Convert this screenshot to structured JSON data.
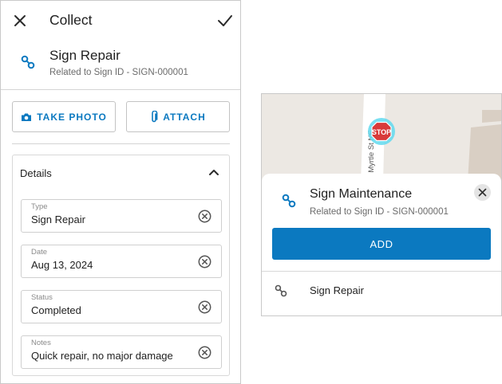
{
  "collect_form": {
    "header": {
      "close_icon": "close-icon",
      "title": "Collect",
      "confirm_icon": "check-icon"
    },
    "feature": {
      "icon": "link-icon",
      "title": "Sign Repair",
      "subtitle": "Related to Sign ID - SIGN-000001"
    },
    "actions": {
      "take_photo": {
        "icon": "camera-icon",
        "label": "TAKE PHOTO"
      },
      "attach": {
        "icon": "paperclip-icon",
        "label": "ATTACH"
      }
    },
    "details": {
      "title": "Details",
      "expanded": true,
      "fields": [
        {
          "label": "Type",
          "value": "Sign Repair"
        },
        {
          "label": "Date",
          "value": "Aug 13, 2024"
        },
        {
          "label": "Status",
          "value": "Completed"
        },
        {
          "label": "Notes",
          "value": "Quick repair, no major damage"
        }
      ]
    }
  },
  "map_popup": {
    "map": {
      "street_label": "Myrtle St NE",
      "marker_label": "STOP"
    },
    "sheet": {
      "icon": "link-icon",
      "title": "Sign Maintenance",
      "subtitle": "Related to Sign ID - SIGN-000001",
      "close_icon": "close-icon",
      "add_label": "ADD",
      "related_items": [
        {
          "icon": "link-icon",
          "label": "Sign Repair"
        }
      ]
    }
  },
  "colors": {
    "accent": "#0b79c0",
    "stop_sign": "#d83a3a",
    "map_background": "#ece8e3",
    "building": "#d9cfc4"
  }
}
